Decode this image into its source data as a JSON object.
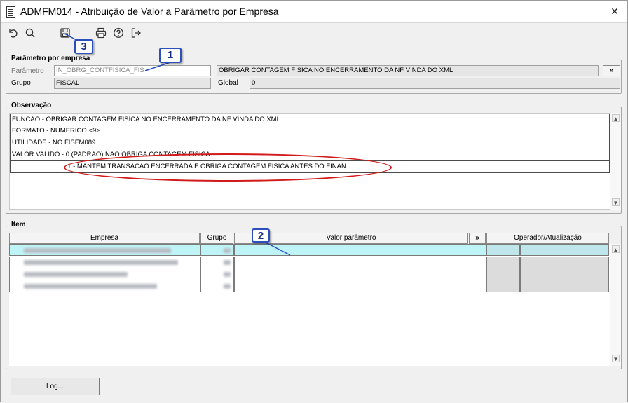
{
  "window": {
    "title": "ADMFM014 - Atribuição de Valor a Parâmetro por Empresa",
    "close_glyph": "✕"
  },
  "toolbar": {
    "icons": [
      "undo-icon",
      "search-icon",
      "save-icon",
      "print-icon",
      "help-icon",
      "exit-icon"
    ]
  },
  "callouts": {
    "one": "1",
    "two": "2",
    "three": "3"
  },
  "parametro_group": {
    "legend": "Parâmetro por empresa",
    "parametro_label": "Parâmetro",
    "parametro_value": "IN_OBRG_CONTFISICA_FIS",
    "descricao_value": "OBRIGAR CONTAGEM FISICA NO ENCERRAMENTO DA NF VINDA DO XML",
    "expand_label": "»",
    "grupo_label": "Grupo",
    "grupo_value": "FISCAL",
    "global_label": "Global",
    "global_value": "0"
  },
  "observacao": {
    "legend": "Observação",
    "lines": [
      "FUNCAO - OBRIGAR CONTAGEM FISICA NO ENCERRAMENTO DA NF VINDA DO XML",
      "FORMATO - NUMERICO <9>",
      "UTILIDADE - NO FISFM089",
      "VALOR VALIDO - 0 (PADRAO) NAO OBRIGA CONTAGEM FISICA",
      "                              1 - MANTEM TRANSACAO ENCERRADA E OBRIGA CONTAGEM FISICA ANTES DO FINAN"
    ]
  },
  "item": {
    "legend": "Item",
    "columns": {
      "empresa": "Empresa",
      "grupo": "Grupo",
      "valor": "Valor parâmetro",
      "expand": "»",
      "operador": "Operador/Atualização"
    },
    "row_count": 4
  },
  "log_button": "Log...",
  "colors": {
    "selected_row": "#bff4f6",
    "callout_border": "#2b4fbd",
    "ellipse": "#d21a1a"
  }
}
